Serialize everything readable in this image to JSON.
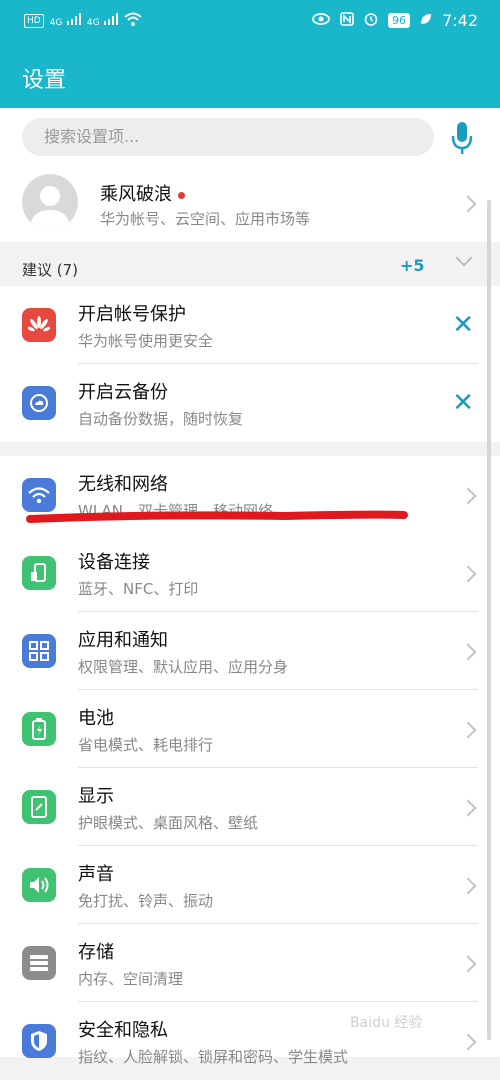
{
  "status": {
    "hd": "HD",
    "sig1": "4G",
    "sig2": "4G",
    "battery": "96",
    "time": "7:42"
  },
  "title": "设置",
  "search": {
    "placeholder": "搜索设置项..."
  },
  "profile": {
    "name": "乘风破浪",
    "sub": "华为帐号、云空间、应用市场等"
  },
  "suggestions": {
    "label": "建议 (7)",
    "more": "+5"
  },
  "suggestion_items": [
    {
      "title": "开启帐号保护",
      "sub": "华为帐号使用更安全",
      "icon": "huawei-icon",
      "color": "#e8493f"
    },
    {
      "title": "开启云备份",
      "sub": "自动备份数据，随时恢复",
      "icon": "cloud-backup-icon",
      "color": "#4a7bd8"
    }
  ],
  "settings_items": [
    {
      "title": "无线和网络",
      "sub": "WLAN、双卡管理、移动网络",
      "icon": "wifi-icon",
      "color": "#4a7bd8"
    },
    {
      "title": "设备连接",
      "sub": "蓝牙、NFC、打印",
      "icon": "device-connect-icon",
      "color": "#3fc272"
    },
    {
      "title": "应用和通知",
      "sub": "权限管理、默认应用、应用分身",
      "icon": "apps-icon",
      "color": "#4a7bd8"
    },
    {
      "title": "电池",
      "sub": "省电模式、耗电排行",
      "icon": "battery-icon",
      "color": "#3fc272"
    },
    {
      "title": "显示",
      "sub": "护眼模式、桌面风格、壁纸",
      "icon": "display-icon",
      "color": "#3fc272"
    },
    {
      "title": "声音",
      "sub": "免打扰、铃声、振动",
      "icon": "sound-icon",
      "color": "#3fc272"
    },
    {
      "title": "存储",
      "sub": "内存、空间清理",
      "icon": "storage-icon",
      "color": "#8c8c8c"
    },
    {
      "title": "安全和隐私",
      "sub": "指纹、人脸解锁、锁屏和密码、学生模式",
      "icon": "shield-icon",
      "color": "#4a7bd8"
    }
  ],
  "watermark": "Baidu 经验"
}
